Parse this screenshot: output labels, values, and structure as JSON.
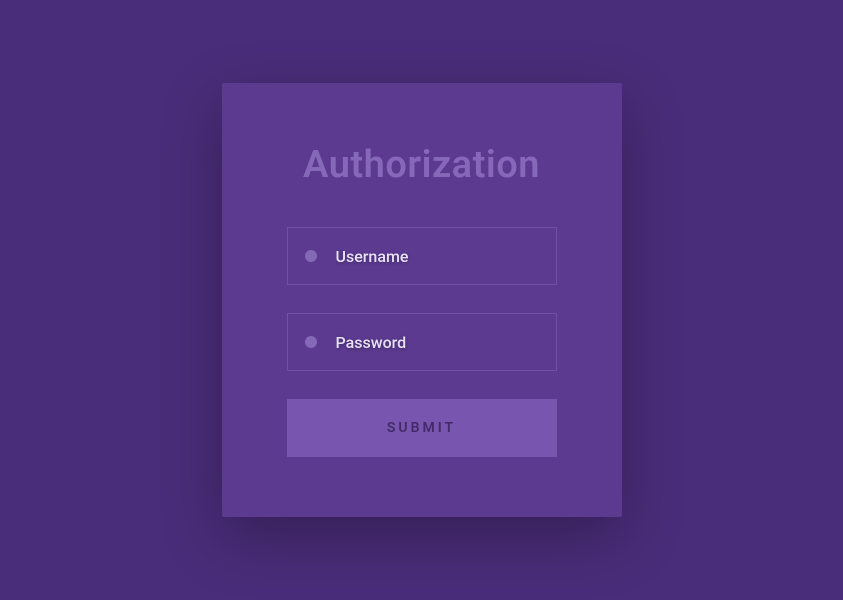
{
  "auth": {
    "title": "Authorization",
    "username_placeholder": "Username",
    "password_placeholder": "Password",
    "submit_label": "SUBMIT"
  }
}
